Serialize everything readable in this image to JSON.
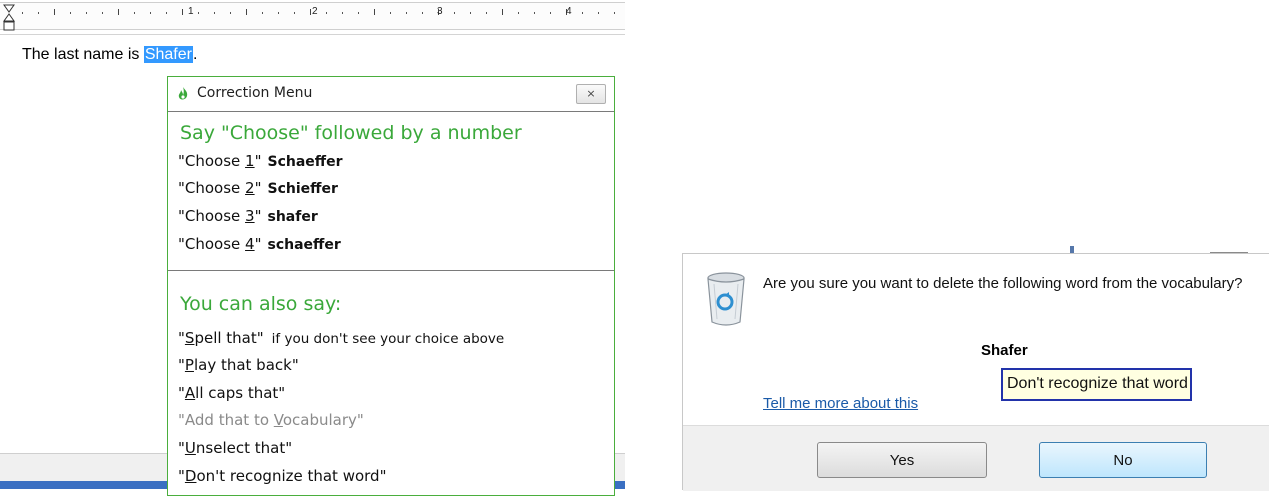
{
  "editor": {
    "ruler_numbers": [
      "1",
      "2",
      "3",
      "4"
    ],
    "text_before": "The last name is ",
    "selected_word": "Shafer",
    "text_after": "."
  },
  "correction_menu": {
    "title": "Correction Menu",
    "close_label": "×",
    "heading": "Say \"Choose\" followed by a number",
    "choices": [
      {
        "prefix": "\"Choose ",
        "num": "1",
        "suffix": "\"",
        "word": "Schaeffer"
      },
      {
        "prefix": "\"Choose ",
        "num": "2",
        "suffix": "\"",
        "word": "Schieffer"
      },
      {
        "prefix": "\"Choose ",
        "num": "3",
        "suffix": "\"",
        "word": "shafer"
      },
      {
        "prefix": "\"Choose ",
        "num": "4",
        "suffix": "\"",
        "word": "schaeffer"
      }
    ],
    "also_heading": "You can also say:",
    "commands": [
      {
        "pre": "\"",
        "key": "S",
        "rest": "pell that\"",
        "note": "if you don't see your choice above",
        "enabled": true
      },
      {
        "pre": "\"",
        "key": "P",
        "rest": "lay that back\"",
        "note": "",
        "enabled": true
      },
      {
        "pre": "\"",
        "key": "A",
        "rest": "ll caps that\"",
        "note": "",
        "enabled": true
      },
      {
        "pre": "\"Add that to ",
        "key": "V",
        "rest": "ocabulary\"",
        "note": "",
        "enabled": false
      },
      {
        "pre": "\"",
        "key": "U",
        "rest": "nselect that\"",
        "note": "",
        "enabled": true
      },
      {
        "pre": "\"",
        "key": "D",
        "rest": "on't recognize that word\"",
        "note": "",
        "enabled": true
      }
    ]
  },
  "delete_dialog": {
    "message": "Are you sure you want to delete the following word from the vocabulary?",
    "word": "Shafer",
    "dont_recognize_label": "Don't recognize that word",
    "link_label": "Tell me more about this",
    "yes_label": "Yes",
    "no_label": "No"
  },
  "colors": {
    "accent_green": "#3aa83a",
    "selection_blue": "#3399ff",
    "link_blue": "#1a5aa8",
    "focus_border": "#2233aa"
  }
}
